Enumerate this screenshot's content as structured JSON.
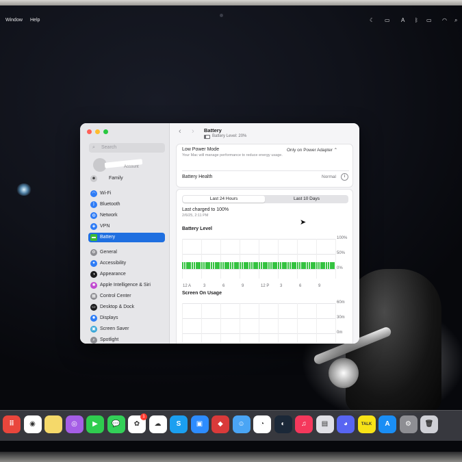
{
  "menubar": {
    "items": [
      "Window",
      "Help"
    ],
    "status_icons": [
      "focus-icon",
      "screen-mirroring-icon",
      "keyboard-icon",
      "bluetooth-icon",
      "battery-icon",
      "wifi-icon",
      "search-icon"
    ]
  },
  "sidebar": {
    "search_placeholder": "Search",
    "account_label": "Account",
    "family_label": "Family",
    "items": [
      {
        "label": "Wi-Fi",
        "icon": "wifi-icon",
        "color": "#2e7cf6"
      },
      {
        "label": "Bluetooth",
        "icon": "bluetooth-icon",
        "color": "#2e7cf6"
      },
      {
        "label": "Network",
        "icon": "globe-icon",
        "color": "#2e7cf6"
      },
      {
        "label": "VPN",
        "icon": "vpn-icon",
        "color": "#2e7cf6"
      },
      {
        "label": "Battery",
        "icon": "battery-icon",
        "color": "#3cba35",
        "selected": true
      },
      {
        "label": "General",
        "icon": "gear-icon",
        "color": "#8e8e93"
      },
      {
        "label": "Accessibility",
        "icon": "accessibility-icon",
        "color": "#2e7cf6"
      },
      {
        "label": "Appearance",
        "icon": "appearance-icon",
        "color": "#1d1d1f"
      },
      {
        "label": "Apple Intelligence & Siri",
        "icon": "siri-icon",
        "color": "#c04ad0"
      },
      {
        "label": "Control Center",
        "icon": "control-center-icon",
        "color": "#8e8e93"
      },
      {
        "label": "Desktop & Dock",
        "icon": "dock-icon",
        "color": "#1d1d1f"
      },
      {
        "label": "Displays",
        "icon": "display-icon",
        "color": "#2e7cf6"
      },
      {
        "label": "Screen Saver",
        "icon": "screen-saver-icon",
        "color": "#3aa7d8"
      },
      {
        "label": "Spotlight",
        "icon": "spotlight-icon",
        "color": "#8e8e93"
      }
    ]
  },
  "header": {
    "title": "Battery",
    "subtitle": "Battery Level: 20%"
  },
  "low_power": {
    "title": "Low Power Mode",
    "description": "Your Mac will manage performance to reduce energy usage.",
    "value": "Only on Power Adapter ⌃"
  },
  "battery_health": {
    "title": "Battery Health",
    "value": "Normal"
  },
  "tabs": [
    "Last 24 Hours",
    "Last 10 Days"
  ],
  "last_charged": {
    "title": "Last charged to 100%",
    "date": "2/6/25, 2:11 PM"
  },
  "chart_data": [
    {
      "type": "bar",
      "title": "Battery Level",
      "yticks": [
        "100%",
        "50%",
        "0%"
      ],
      "ylim": [
        0,
        100
      ],
      "xticks": [
        "12 A",
        "3",
        "6",
        "9",
        "12 P",
        "3",
        "6",
        "9"
      ],
      "bar_count": 80,
      "values_percent_constant": 20
    },
    {
      "type": "bar",
      "title": "Screen On Usage",
      "yticks": [
        "60m",
        "30m",
        "0m"
      ],
      "ylim": [
        0,
        60
      ],
      "xticks": [
        "12 A",
        "3",
        "6",
        "9",
        "12 P",
        "3",
        "6",
        "9"
      ],
      "values": []
    }
  ],
  "dock": [
    {
      "name": "launchpad-icon",
      "color": "#e9463c",
      "glyph": "⠿"
    },
    {
      "name": "chrome-icon",
      "color": "#ffffff",
      "glyph": "◉"
    },
    {
      "name": "notes-icon",
      "color": "#f5d96a",
      "glyph": ""
    },
    {
      "name": "podcasts-icon",
      "color": "#a55ee6",
      "glyph": "◎"
    },
    {
      "name": "facetime-icon",
      "color": "#2fcc4f",
      "glyph": "▶"
    },
    {
      "name": "messages-icon",
      "color": "#33d058",
      "glyph": "💬"
    },
    {
      "name": "photos-icon",
      "color": "#ffffff",
      "glyph": "✿"
    },
    {
      "name": "icloud-icon",
      "color": "#ffffff",
      "glyph": "☁"
    },
    {
      "name": "s-app-icon",
      "color": "#1b9ff0",
      "glyph": "S"
    },
    {
      "name": "zoom-icon",
      "color": "#2d8cff",
      "glyph": "▣"
    },
    {
      "name": "vpn-app-icon",
      "color": "#d93a3a",
      "glyph": "◆"
    },
    {
      "name": "finder-icon",
      "color": "#4aa5f5",
      "glyph": "☺"
    },
    {
      "name": "clock-icon",
      "color": "#ffffff",
      "glyph": "◔"
    },
    {
      "name": "steam-icon",
      "color": "#1b2838",
      "glyph": "◐"
    },
    {
      "name": "music-icon",
      "color": "#f5385c",
      "glyph": "♫"
    },
    {
      "name": "preview-icon",
      "color": "#e0e0e6",
      "glyph": "▤"
    },
    {
      "name": "discord-icon",
      "color": "#5865f2",
      "glyph": "◕"
    },
    {
      "name": "kakaotalk-icon",
      "color": "#f7e317",
      "glyph": "TALK"
    },
    {
      "name": "app-store-icon",
      "color": "#1a8ef5",
      "glyph": "A"
    },
    {
      "name": "system-settings-icon",
      "color": "#8e8e93",
      "glyph": "⚙"
    },
    {
      "name": "trash-icon",
      "color": "#cfd0d6",
      "glyph": "🗑"
    }
  ],
  "dock_badge": "1"
}
